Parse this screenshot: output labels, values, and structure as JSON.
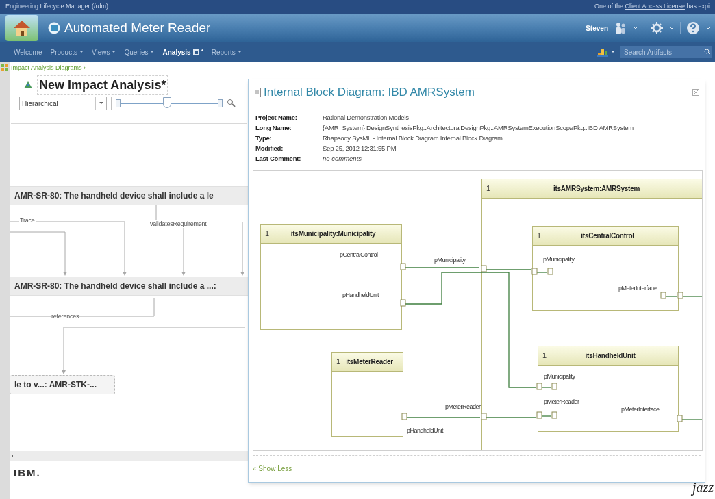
{
  "top_bar": {
    "app_name": "Engineering Lifecycle Manager (/rdm)",
    "notice": {
      "before": "One of the",
      "link": "Client Access License",
      "after": "has expi"
    }
  },
  "banner": {
    "title": "Automated Meter Reader",
    "user": "Steven"
  },
  "nav": {
    "items": [
      {
        "label": "Welcome",
        "dropdown": false,
        "selected": false,
        "marker": ""
      },
      {
        "label": "Products",
        "dropdown": true,
        "selected": false,
        "marker": ""
      },
      {
        "label": "Views",
        "dropdown": true,
        "selected": false,
        "marker": ""
      },
      {
        "label": "Queries",
        "dropdown": true,
        "selected": false,
        "marker": ""
      },
      {
        "label": "Analysis",
        "dropdown": false,
        "selected": true,
        "marker": "*"
      },
      {
        "label": "Reports",
        "dropdown": true,
        "selected": false,
        "marker": ""
      }
    ],
    "search": {
      "placeholder": "Search Artifacts"
    }
  },
  "breadcrumb": "Impact Analysis Diagrams ›",
  "analysis": {
    "title": "New Impact Analysis*",
    "layout": "Hierarchical",
    "zoom": {
      "level": 0.48
    },
    "nodes": [
      {
        "text": "AMR-SR-80: The handheld device shall include a le",
        "kind": "artifact"
      },
      {
        "text": "AMR-SR-80: The handheld device shall include a ...:",
        "kind": "artifact"
      },
      {
        "text": "le to v...: AMR-STK-...",
        "kind": "unresolved"
      }
    ],
    "edge_labels": [
      "Trace",
      "validatesRequirement",
      "references"
    ]
  },
  "popup": {
    "title": "Internal Block Diagram: IBD AMRSystem",
    "fields": [
      {
        "label": "Project Name:",
        "value": "Rational Demonstration Models",
        "kind": "text"
      },
      {
        "label": "Long Name:",
        "value": "{AMR_System} DesignSynthesisPkg::ArchitecturalDesignPkg::AMRSystemExecutionScopePkg::IBD AMRSystem",
        "kind": "text"
      },
      {
        "label": "Type:",
        "value": "Rhapsody SysML - Internal Block Diagram Internal Block Diagram",
        "kind": "text"
      },
      {
        "label": "Modified:",
        "value": "Sep 25, 2012 12:31:55 PM",
        "kind": "text"
      },
      {
        "label": "Last Comment:",
        "value": "no comments",
        "kind": "note"
      }
    ],
    "diagram": {
      "blocks": [
        {
          "multiplicity": "1",
          "name": "itsAMRSystem:AMRSystem"
        },
        {
          "multiplicity": "1",
          "name": "itsMunicipality:Municipality"
        },
        {
          "multiplicity": "1",
          "name": "itsCentralControl"
        },
        {
          "multiplicity": "1",
          "name": "itsMeterReader"
        },
        {
          "multiplicity": "1",
          "name": "itsHandheldUnit"
        }
      ],
      "port_labels": [
        "pCentralControl",
        "pHandheldUnit",
        "pMunicipality",
        "pMunicipality",
        "pMeterInterface",
        "pMunicipality",
        "pMeterReader",
        "pMeterInterface",
        "pMeterReader",
        "pHandheldUnit"
      ]
    },
    "show_less": "« Show Less"
  },
  "footer": {
    "logo": "IBM.",
    "brand": "jazz"
  }
}
